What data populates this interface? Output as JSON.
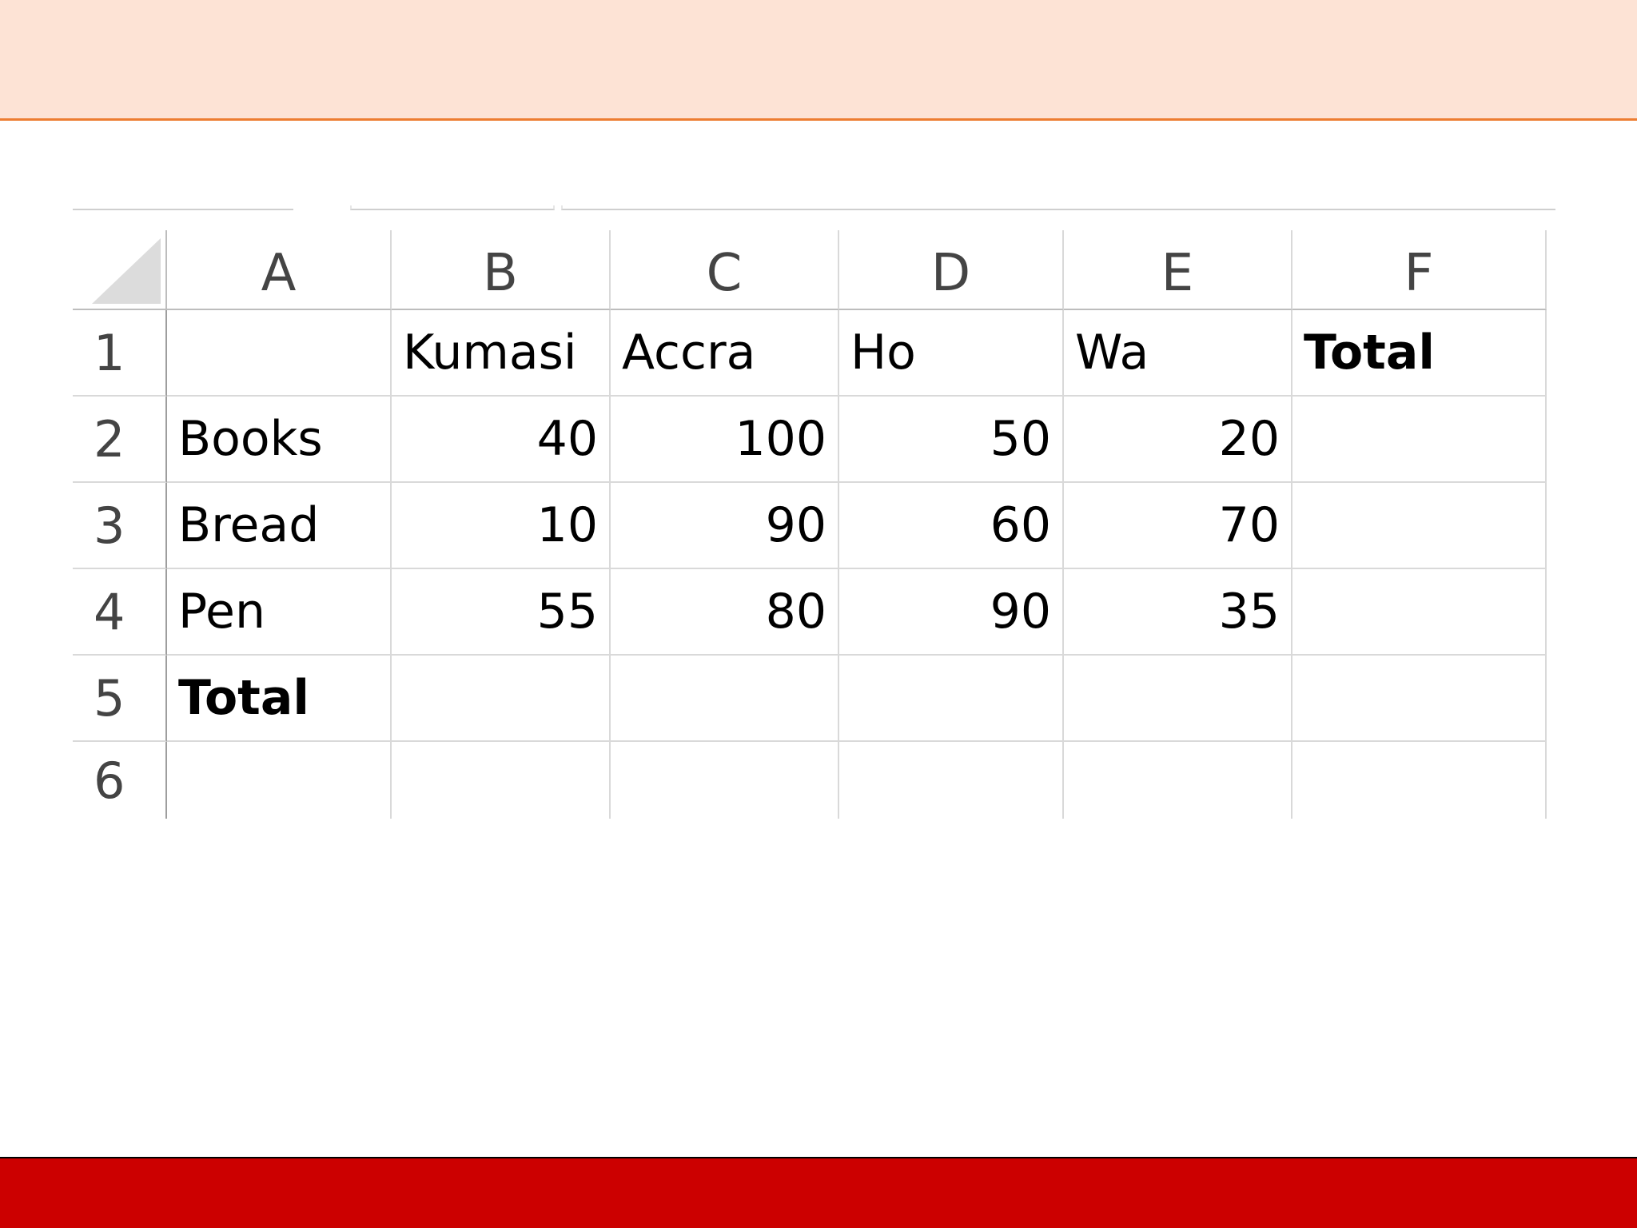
{
  "spreadsheet": {
    "columns": [
      "A",
      "B",
      "C",
      "D",
      "E",
      "F"
    ],
    "rows": [
      {
        "num": "1",
        "cells": [
          "",
          "Kumasi",
          "Accra",
          "Ho",
          "Wa",
          "Total"
        ]
      },
      {
        "num": "2",
        "cells": [
          "Books",
          "40",
          "100",
          "50",
          "20",
          ""
        ]
      },
      {
        "num": "3",
        "cells": [
          "Bread",
          "10",
          "90",
          "60",
          "70",
          ""
        ]
      },
      {
        "num": "4",
        "cells": [
          "Pen",
          "55",
          "80",
          "90",
          "35",
          ""
        ]
      },
      {
        "num": "5",
        "cells": [
          "Total",
          "",
          "",
          "",
          "",
          ""
        ]
      },
      {
        "num": "6",
        "cells": [
          "",
          "",
          "",
          "",
          "",
          ""
        ]
      }
    ]
  },
  "colors": {
    "top_band": "#fde3d5",
    "top_band_border": "#ed7d31",
    "bottom_band": "#cc0000"
  }
}
